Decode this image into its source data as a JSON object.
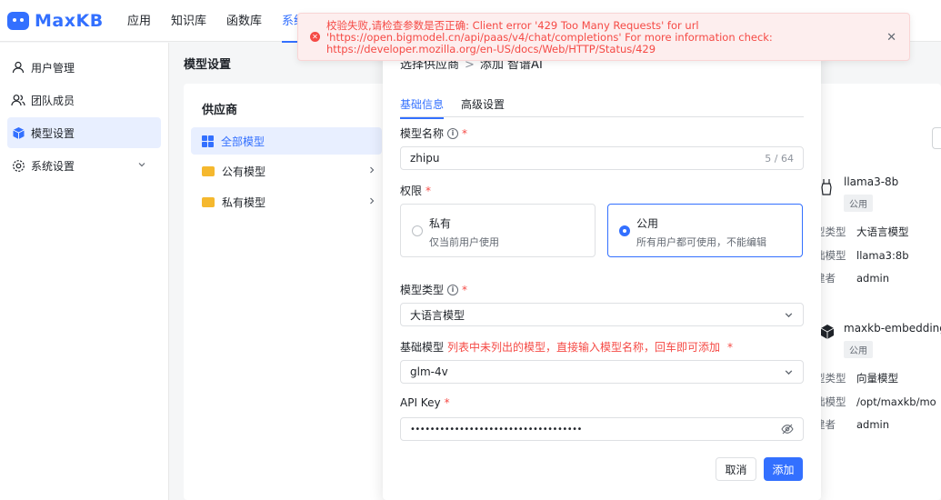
{
  "app": {
    "logo_text": "MaxKB",
    "brand_color": "#3370ff"
  },
  "topnav": {
    "tabs": [
      {
        "label": "应用"
      },
      {
        "label": "知识库"
      },
      {
        "label": "函数库"
      },
      {
        "label": "系统"
      }
    ]
  },
  "sidebar": {
    "items": [
      {
        "label": "用户管理",
        "icon": "user-icon"
      },
      {
        "label": "团队成员",
        "icon": "team-icon"
      },
      {
        "label": "模型设置",
        "icon": "cube-icon"
      },
      {
        "label": "系统设置",
        "icon": "gear-icon"
      }
    ]
  },
  "main": {
    "title": "模型设置",
    "provider_title": "供应商",
    "providers": [
      {
        "label": "全部模型"
      },
      {
        "label": "公有模型"
      },
      {
        "label": "私有模型"
      }
    ]
  },
  "cards": [
    {
      "name": "llama3-8b",
      "badge": "公用",
      "rows": [
        {
          "key": "型类型",
          "value": "大语言模型"
        },
        {
          "key": "础模型",
          "value": "llama3:8b"
        },
        {
          "key": "建者",
          "value": "admin"
        }
      ]
    },
    {
      "name": "maxkb-embedding",
      "badge": "公用",
      "rows": [
        {
          "key": "型类型",
          "value": "向量模型"
        },
        {
          "key": "础模型",
          "value": "/opt/maxkb/mo"
        },
        {
          "key": "建者",
          "value": "admin"
        }
      ]
    }
  ],
  "dialog": {
    "breadcrumb": {
      "step1": "选择供应商",
      "sep": ">",
      "step2": "添加 智谱AI"
    },
    "tabs": [
      {
        "label": "基础信息"
      },
      {
        "label": "高级设置"
      }
    ],
    "model_name": {
      "label": "模型名称",
      "value": "zhipu",
      "count": "5 / 64"
    },
    "permission": {
      "label": "权限",
      "options": [
        {
          "title": "私有",
          "desc": "仅当前用户使用"
        },
        {
          "title": "公用",
          "desc": "所有用户都可使用，不能编辑"
        }
      ]
    },
    "model_type": {
      "label": "模型类型",
      "value": "大语言模型"
    },
    "base_model": {
      "label": "基础模型",
      "hint": "列表中未列出的模型，直接输入模型名称，回车即可添加",
      "value": "glm-4v"
    },
    "api_key": {
      "label": "API Key",
      "value": "••••••••••••••••••••••••••••••••••••••••••••••••••••"
    },
    "buttons": {
      "cancel": "取消",
      "add": "添加"
    }
  },
  "toast": {
    "message": "校验失败,请检查参数是否正确: Client error '429 Too Many Requests' for url 'https://open.bigmodel.cn/api/paas/v4/chat/completions' For more information check: https://developer.mozilla.org/en-US/docs/Web/HTTP/Status/429",
    "close": "✕",
    "error_color": "#f54a45"
  }
}
